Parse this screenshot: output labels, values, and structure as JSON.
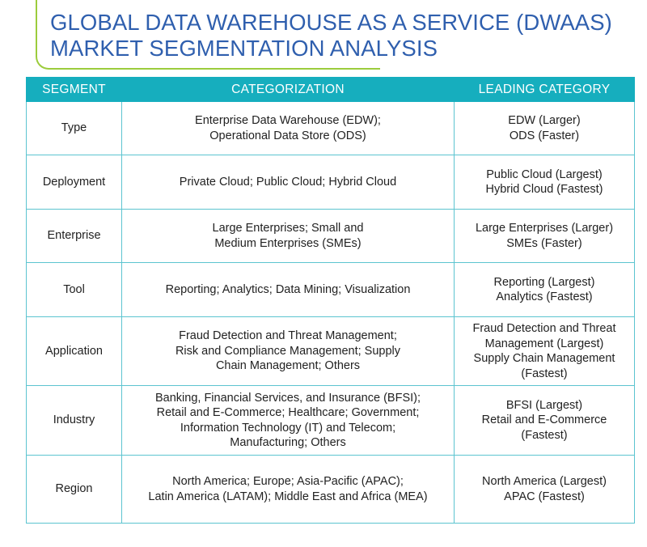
{
  "title": {
    "line1": "GLOBAL DATA WAREHOUSE AS A SERVICE (DWAAS)",
    "line2": "MARKET SEGMENTATION ANALYSIS"
  },
  "colors": {
    "title": "#2f5fae",
    "accent_green": "#9ccc3c",
    "header_bg": "#16aebe",
    "border": "#5cc4d0"
  },
  "table": {
    "headers": [
      "SEGMENT",
      "CATEGORIZATION",
      "LEADING CATEGORY"
    ],
    "rows": [
      {
        "segment": "Type",
        "categorization": [
          "Enterprise Data Warehouse (EDW);",
          "Operational Data Store (ODS)"
        ],
        "leading": [
          "EDW (Larger)",
          "ODS (Faster)"
        ]
      },
      {
        "segment": "Deployment",
        "categorization": [
          "Private Cloud; Public Cloud; Hybrid Cloud"
        ],
        "leading": [
          "Public Cloud (Largest)",
          "Hybrid Cloud (Fastest)"
        ]
      },
      {
        "segment": "Enterprise",
        "categorization": [
          "Large Enterprises; Small and",
          "Medium Enterprises (SMEs)"
        ],
        "leading": [
          "Large Enterprises (Larger)",
          "SMEs (Faster)"
        ]
      },
      {
        "segment": "Tool",
        "categorization": [
          "Reporting; Analytics; Data Mining; Visualization"
        ],
        "leading": [
          "Reporting (Largest)",
          "Analytics (Fastest)"
        ]
      },
      {
        "segment": "Application",
        "categorization": [
          "Fraud Detection and Threat Management;",
          "Risk and Compliance Management; Supply",
          "Chain Management; Others"
        ],
        "leading": [
          "Fraud Detection and Threat",
          "Management (Largest)",
          "Supply Chain Management",
          "(Fastest)"
        ]
      },
      {
        "segment": "Industry",
        "categorization": [
          "Banking, Financial Services, and Insurance (BFSI);",
          "Retail and E-Commerce; Healthcare; Government;",
          "Information Technology (IT) and Telecom;",
          "Manufacturing; Others"
        ],
        "leading": [
          "BFSI (Largest)",
          "Retail and E-Commerce",
          "(Fastest)"
        ]
      },
      {
        "segment": "Region",
        "categorization": [
          "North America; Europe; Asia-Pacific (APAC);",
          "Latin America (LATAM); Middle East and Africa (MEA)"
        ],
        "leading": [
          "North America (Largest)",
          "APAC (Fastest)"
        ]
      }
    ]
  }
}
